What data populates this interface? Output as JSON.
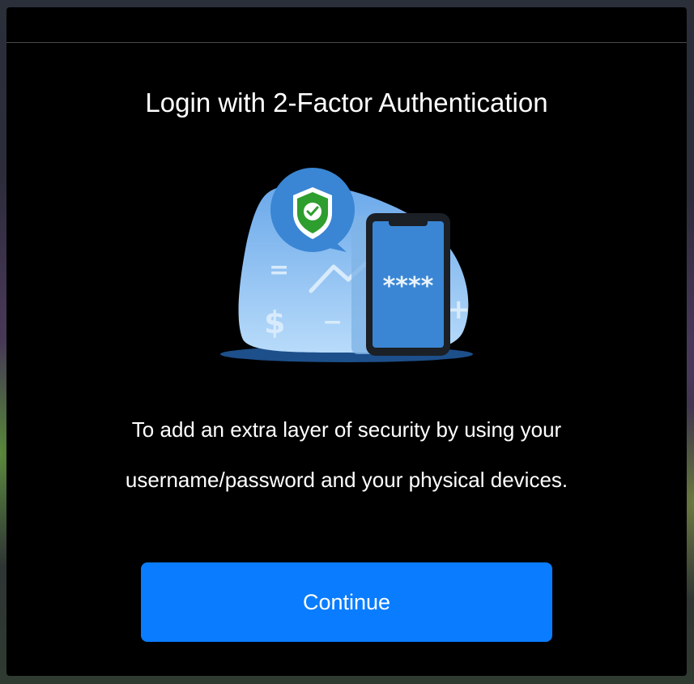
{
  "dialog": {
    "title": "Login with 2-Factor Authentication",
    "description_lines": [
      "To add an extra layer of security by using your",
      "username/password and your physical devices."
    ],
    "continue_label": "Continue"
  },
  "illustration": {
    "phone_code": "****",
    "icons": [
      "shield-check-icon",
      "smartphone-icon",
      "dollar-icon",
      "equals-icon",
      "minus-icon",
      "plus-icon",
      "trend-line-icon"
    ],
    "glyphs": {
      "dollar": "$",
      "equals": "=",
      "minus": "−",
      "plus": "+"
    }
  },
  "colors": {
    "accent": "#0a7cff",
    "modal_background": "#000000",
    "blob_light": "#a9d0f7",
    "blob_dark": "#5ba0e8",
    "shield_green": "#2e9e2e",
    "bubble_blue": "#3a86d4",
    "phone_screen": "#3a86d4"
  }
}
